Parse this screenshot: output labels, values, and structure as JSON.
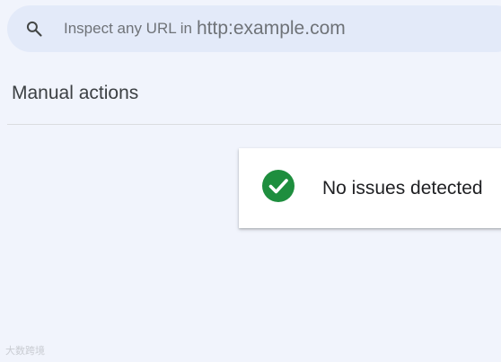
{
  "search": {
    "prefix": "Inspect any URL in",
    "domain": "http:example.com",
    "icon": "search-icon"
  },
  "manual_actions": {
    "title": "Manual actions"
  },
  "status_card": {
    "icon": "check-circle-icon",
    "icon_color": "#1e8e3e",
    "text": "No issues detected"
  },
  "watermark": {
    "text": "大数跨境"
  },
  "colors": {
    "page_background": "#f1f4fc",
    "search_background": "#e3eaf9",
    "success": "#1e8e3e"
  }
}
